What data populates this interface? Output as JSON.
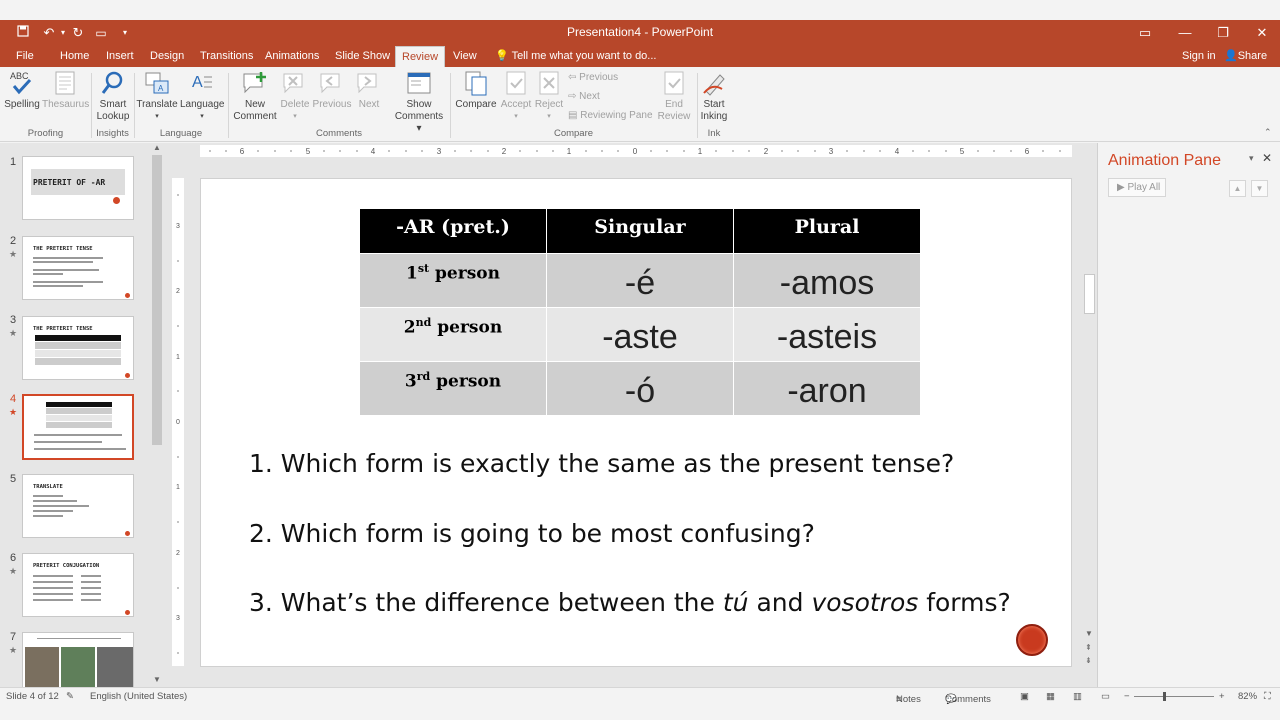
{
  "window": {
    "title": "Presentation4 - PowerPoint",
    "signin": "Sign in",
    "share": "Share"
  },
  "tabs": [
    "File",
    "Home",
    "Insert",
    "Design",
    "Transitions",
    "Animations",
    "Slide Show",
    "Review",
    "View"
  ],
  "active_tab": "Review",
  "tellme": "Tell me what you want to do...",
  "ribbon": {
    "spelling": "Spelling",
    "thesaurus": "Thesaurus",
    "smart_lookup": "Smart Lookup",
    "translate": "Translate",
    "language": "Language",
    "new_comment": "New Comment",
    "delete": "Delete",
    "previous": "Previous",
    "next": "Next",
    "show_comments": "Show Comments",
    "compare": "Compare",
    "accept": "Accept",
    "reject": "Reject",
    "compare_previous": "Previous",
    "compare_next": "Next",
    "reviewing_pane": "Reviewing Pane",
    "end_review": "End Review",
    "start_inking": "Start Inking",
    "groups": {
      "proofing": "Proofing",
      "insights": "Insights",
      "language": "Language",
      "comments": "Comments",
      "compare": "Compare",
      "ink": "Ink"
    }
  },
  "thumbnails": [
    {
      "num": "1",
      "title": "PRETERIT OF -AR"
    },
    {
      "num": "2",
      "title": "THE PRETERIT TENSE"
    },
    {
      "num": "3",
      "title": "THE PRETERIT TENSE"
    },
    {
      "num": "4",
      "title": ""
    },
    {
      "num": "5",
      "title": "TRANSLATE"
    },
    {
      "num": "6",
      "title": "PRETERIT CONJUGATION"
    },
    {
      "num": "7",
      "title": ""
    }
  ],
  "slide": {
    "table": {
      "header": [
        "-AR (pret.)",
        "Singular",
        "Plural"
      ],
      "rows": [
        {
          "num": "1",
          "sup": "st",
          "label": "person",
          "singular": "-é",
          "plural": "-amos"
        },
        {
          "num": "2",
          "sup": "nd",
          "label": "person",
          "singular": "-aste",
          "plural": "-asteis"
        },
        {
          "num": "3",
          "sup": "rd",
          "label": "person",
          "singular": "-ó",
          "plural": "-aron"
        }
      ]
    },
    "q1": "1. Which form is exactly the same as the present tense?",
    "q2": "2. Which form is going to be most confusing?",
    "q3_a": "3. What’s the difference between the ",
    "q3_tu": "tú",
    "q3_b": " and ",
    "q3_vos": "vosotros",
    "q3_c": " forms?"
  },
  "anim_pane": {
    "title": "Animation Pane",
    "play_all": "Play All"
  },
  "status": {
    "slide": "Slide 4 of 12",
    "language": "English (United States)",
    "notes": "Notes",
    "comments": "Comments",
    "zoom": "82%"
  },
  "colors": {
    "brand": "#b7472a",
    "accent": "#d24726"
  }
}
